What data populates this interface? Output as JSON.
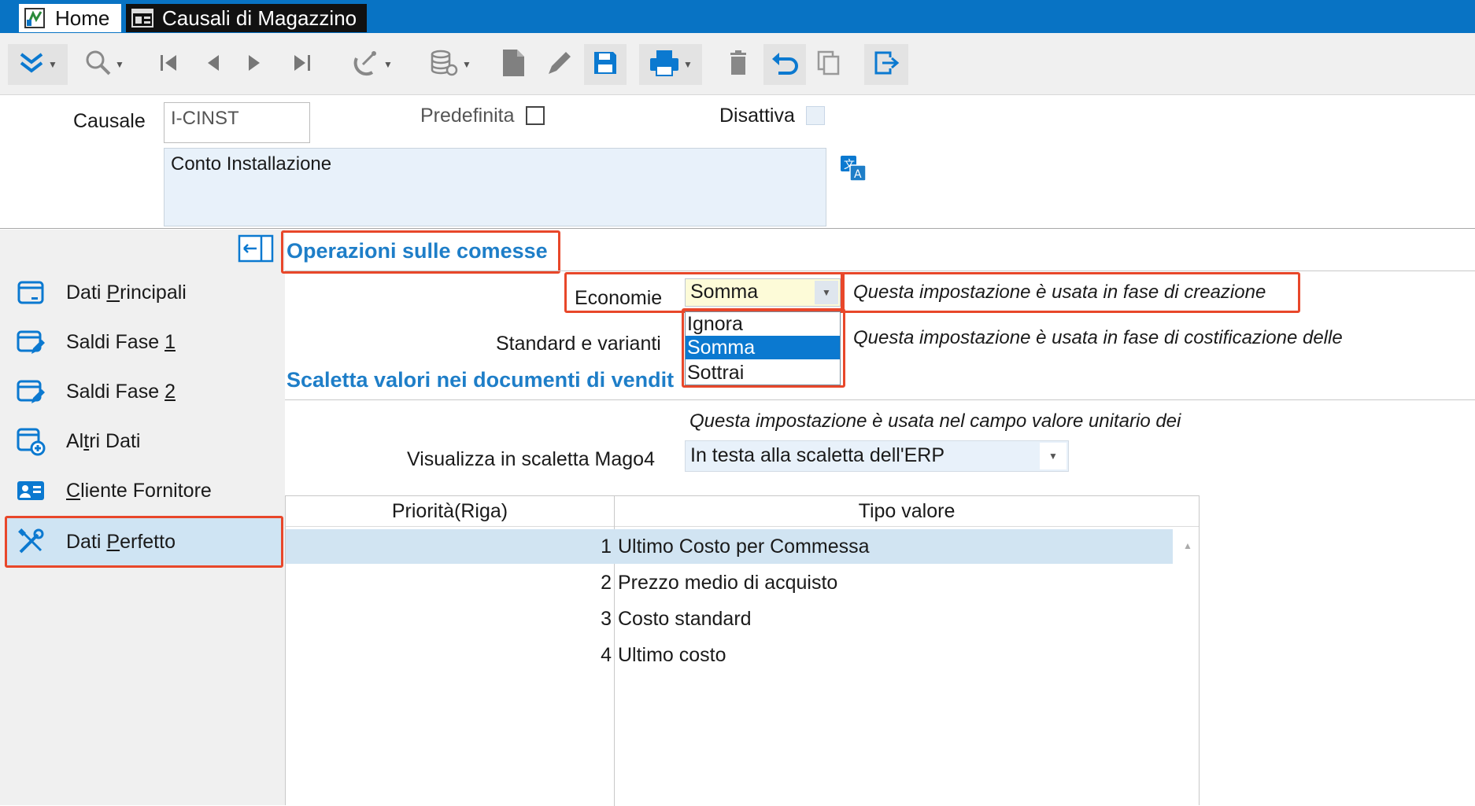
{
  "window": {
    "tabs": [
      {
        "label": "Home",
        "icon": "home-app-icon"
      },
      {
        "label": "Causali di Magazzino",
        "icon": "form-window-icon"
      }
    ]
  },
  "toolbar": {
    "icons": [
      "expand-icon",
      "search-icon",
      "first-record-icon",
      "previous-record-icon",
      "next-record-icon",
      "last-record-icon",
      "radar-icon",
      "database-icon",
      "new-document-icon",
      "edit-icon",
      "save-icon",
      "print-icon",
      "delete-icon",
      "undo-icon",
      "copy-icon",
      "exit-icon"
    ]
  },
  "header": {
    "causale_label": "Causale",
    "causale_value": "I-CINST",
    "predefinita_label": "Predefinita",
    "predefinita_checked": false,
    "disattiva_label": "Disattiva",
    "disattiva_checked": false,
    "description": "Conto Installazione",
    "translate_icon": "translate-icon"
  },
  "sidebar": {
    "collapse_icon": "collapse-panel-icon",
    "items": [
      {
        "label_pre": "Dati ",
        "label_u": "P",
        "label_post": "rincipali",
        "icon": "card-icon"
      },
      {
        "label_pre": "Saldi Fase ",
        "label_u": "1",
        "label_post": "",
        "icon": "edit-card-icon"
      },
      {
        "label_pre": "Saldi Fase ",
        "label_u": "2",
        "label_post": "",
        "icon": "edit-card-icon"
      },
      {
        "label_pre": "Al",
        "label_u": "t",
        "label_post": "ri Dati",
        "icon": "add-card-icon"
      },
      {
        "label_pre": "",
        "label_u": "C",
        "label_post": "liente Fornitore",
        "icon": "contact-card-icon"
      },
      {
        "label_pre": "Dati ",
        "label_u": "P",
        "label_post": "erfetto",
        "icon": "tools-icon"
      }
    ],
    "selected_index": 5
  },
  "main": {
    "section1_title": "Operazioni sulle comesse",
    "economie_label": "Economie",
    "economie_value": "Somma",
    "economie_hint": "Questa impostazione è usata in fase di creazione",
    "standard_label": "Standard e varianti",
    "standard_hint": "Questa impostazione è usata in fase di costificazione delle",
    "dropdown_options": [
      "Ignora",
      "Somma",
      "Sottrai"
    ],
    "dropdown_selected": "Somma",
    "section2_title": "Scaletta valori nei documenti di vendit",
    "scaletta_hint": "Questa impostazione è usata nel campo valore unitario dei",
    "visualizza_label": "Visualizza in scaletta Mago4",
    "visualizza_value": "In testa alla scaletta dell'ERP"
  },
  "grid": {
    "columns": [
      "Priorità(Riga)",
      "Tipo valore"
    ],
    "rows": [
      {
        "priority": "1",
        "type": "Ultimo Costo per Commessa"
      },
      {
        "priority": "2",
        "type": "Prezzo medio di acquisto"
      },
      {
        "priority": "3",
        "type": "Costo standard"
      },
      {
        "priority": "4",
        "type": "Ultimo costo"
      }
    ],
    "selected_row": 0
  },
  "colors": {
    "titlebar": "#0873c4",
    "accent_text": "#1e7ec8",
    "highlight_border": "#e8472a",
    "selection": "#0b79d0"
  }
}
